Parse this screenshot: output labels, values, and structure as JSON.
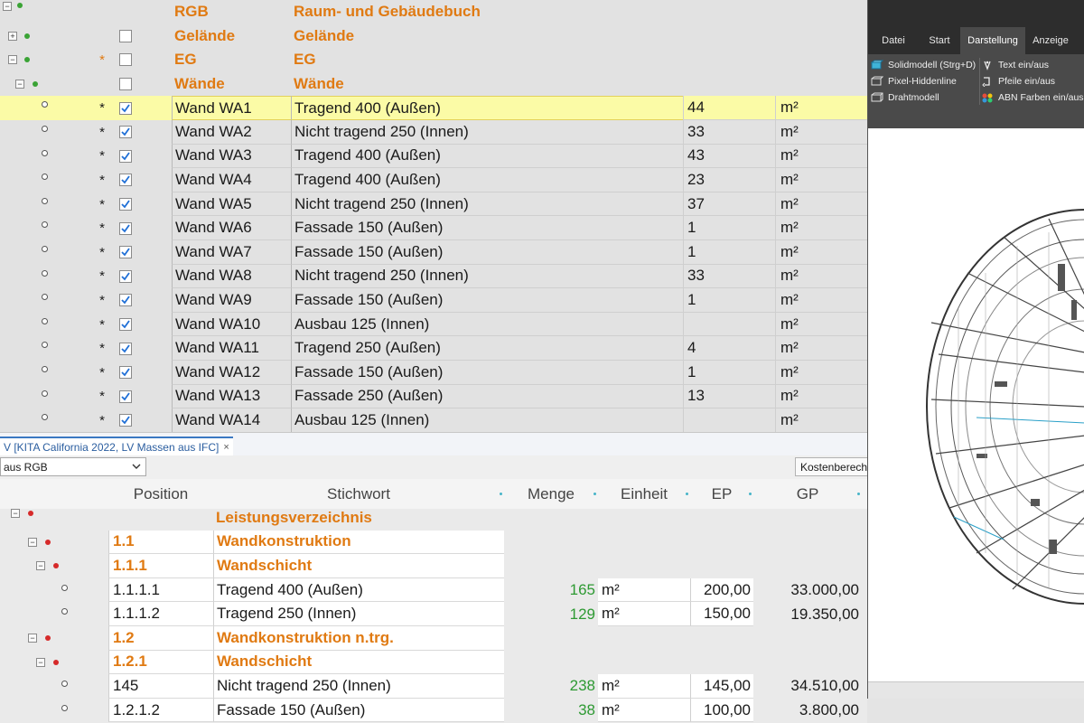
{
  "tree": {
    "headers": [
      {
        "name": "RGB",
        "desc": "Raum- und Gebäudebuch",
        "star": "",
        "checkbox": false
      },
      {
        "name": "Gelände",
        "desc": "Gelände",
        "star": "",
        "checkbox": true
      },
      {
        "name": "EG",
        "desc": "EG",
        "star": "*",
        "checkbox": true
      },
      {
        "name": "Wände",
        "desc": "Wände",
        "star": "",
        "checkbox": true
      }
    ],
    "items": [
      {
        "star": "*",
        "checked": true,
        "name": "Wand WA1",
        "desc": "Tragend 400 (Außen)",
        "qty": "44",
        "unit": "m²",
        "selected": true
      },
      {
        "star": "*",
        "checked": true,
        "name": "Wand WA2",
        "desc": "Nicht tragend 250 (Innen)",
        "qty": "33",
        "unit": "m²"
      },
      {
        "star": "*",
        "checked": true,
        "name": "Wand WA3",
        "desc": "Tragend 400 (Außen)",
        "qty": "43",
        "unit": "m²"
      },
      {
        "star": "*",
        "checked": true,
        "name": "Wand WA4",
        "desc": "Tragend 400 (Außen)",
        "qty": "23",
        "unit": "m²"
      },
      {
        "star": "*",
        "checked": true,
        "name": "Wand WA5",
        "desc": "Nicht tragend 250 (Innen)",
        "qty": "37",
        "unit": "m²"
      },
      {
        "star": "*",
        "checked": true,
        "name": "Wand WA6",
        "desc": "Fassade 150 (Außen)",
        "qty": "1",
        "unit": "m²"
      },
      {
        "star": "*",
        "checked": true,
        "name": "Wand WA7",
        "desc": "Fassade 150 (Außen)",
        "qty": "1",
        "unit": "m²"
      },
      {
        "star": "*",
        "checked": true,
        "name": "Wand WA8",
        "desc": "Nicht tragend 250 (Innen)",
        "qty": "33",
        "unit": "m²"
      },
      {
        "star": "*",
        "checked": true,
        "name": "Wand WA9",
        "desc": "Fassade 150 (Außen)",
        "qty": "1",
        "unit": "m²"
      },
      {
        "star": "*",
        "checked": true,
        "name": "Wand WA10",
        "desc": "Ausbau 125 (Innen)",
        "qty": "",
        "unit": "m²"
      },
      {
        "star": "*",
        "checked": true,
        "name": "Wand WA11",
        "desc": "Tragend 250 (Außen)",
        "qty": "4",
        "unit": "m²"
      },
      {
        "star": "*",
        "checked": true,
        "name": "Wand WA12",
        "desc": "Fassade 150 (Außen)",
        "qty": "1",
        "unit": "m²"
      },
      {
        "star": "*",
        "checked": true,
        "name": "Wand WA13",
        "desc": "Fassade 250 (Außen)",
        "qty": "13",
        "unit": "m²"
      },
      {
        "star": "*",
        "checked": true,
        "name": "Wand WA14",
        "desc": "Ausbau 125 (Innen)",
        "qty": "",
        "unit": "m²"
      }
    ]
  },
  "tab": {
    "label": "V [KITA California 2022, LV Massen aus IFC]",
    "close": "×"
  },
  "toolbar": {
    "source_value": "aus RGB",
    "cost_button": "Kostenberechn"
  },
  "lv": {
    "columns": {
      "position": "Position",
      "stichwort": "Stichwort",
      "menge": "Menge",
      "einheit": "Einheit",
      "ep": "EP",
      "gp": "GP"
    },
    "rows": [
      {
        "type": "root",
        "kw": "Leistungsverzeichnis"
      },
      {
        "type": "group",
        "pos": "1.1",
        "kw": "Wandkonstruktion"
      },
      {
        "type": "group",
        "pos": "1.1.1",
        "kw": "Wandschicht"
      },
      {
        "type": "item",
        "pos": "1.1.1.1",
        "kw": "Tragend 400 (Außen)",
        "qty": "165",
        "unit": "m²",
        "ep": "200,00",
        "gp": "33.000,00"
      },
      {
        "type": "item",
        "pos": "1.1.1.2",
        "kw": "Tragend 250 (Innen)",
        "qty": "129",
        "unit": "m²",
        "ep": "150,00",
        "gp": "19.350,00"
      },
      {
        "type": "group",
        "pos": "1.2",
        "kw": "Wandkonstruktion n.trg."
      },
      {
        "type": "group",
        "pos": "1.2.1",
        "kw": "Wandschicht"
      },
      {
        "type": "item",
        "pos": "145",
        "kw": "Nicht tragend 250 (Innen)",
        "qty": "238",
        "unit": "m²",
        "ep": "145,00",
        "gp": "34.510,00"
      },
      {
        "type": "item",
        "pos": "1.2.1.2",
        "kw": "Fassade 150 (Außen)",
        "qty": "38",
        "unit": "m²",
        "ep": "100,00",
        "gp": "3.800,00"
      }
    ]
  },
  "viewer": {
    "tabs": [
      "Datei",
      "Start",
      "Darstellung",
      "Anzeige"
    ],
    "active_tab": "Darstellung",
    "ribbon_left": [
      {
        "label": "Solidmodell (Strg+D)",
        "icon": "solid-model-icon"
      },
      {
        "label": "Pixel-Hiddenline",
        "icon": "hiddenline-icon"
      },
      {
        "label": "Drahtmodell",
        "icon": "wireframe-icon"
      }
    ],
    "ribbon_right": [
      {
        "label": "Text ein/aus",
        "icon": "text-toggle-icon"
      },
      {
        "label": "Pfeile ein/aus",
        "icon": "arrows-toggle-icon"
      },
      {
        "label": "ABN Farben ein/aus (S",
        "icon": "color-toggle-icon"
      }
    ]
  },
  "colors": {
    "accent_orange": "#e07a12",
    "green_qty": "#2e9a33",
    "selection_yellow": "#fbfba6",
    "check_blue": "#1f6fd6"
  }
}
